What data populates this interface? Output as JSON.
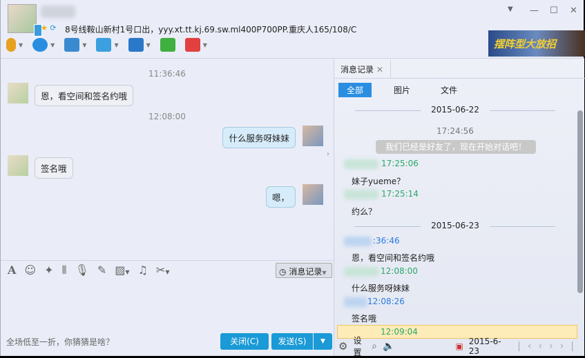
{
  "header": {
    "signature": "8号线鞍山新村1号口出，yyy.xt.tt.kj.69.sw.ml400P700PP.重庆人165/108/C",
    "ad_text": "摆阵型大放招",
    "window_buttons": [
      "menu",
      "minimize",
      "maximize",
      "close"
    ]
  },
  "toolbar": [
    {
      "icon": "microphone-icon",
      "color": "#e8a020"
    },
    {
      "icon": "camera-icon",
      "color": "#2a8ee0"
    },
    {
      "icon": "screen-share-icon",
      "color": "#3a8ad0"
    },
    {
      "icon": "file-transfer-icon",
      "color": "#3aa0e0"
    },
    {
      "icon": "remote-desktop-icon",
      "color": "#2a78c8"
    },
    {
      "icon": "add-chat-icon",
      "color": "#40b040"
    },
    {
      "icon": "apps-icon",
      "color": "#e04040"
    }
  ],
  "chat": {
    "messages": [
      {
        "time": "11:36:46",
        "text": "恩，看空间和签名约哦",
        "from": "them"
      },
      {
        "time": "12:08:00",
        "text": "什么服务呀妹妹",
        "from": "me"
      },
      {
        "text": "签名哦",
        "from": "them"
      },
      {
        "text": "嗯，",
        "from": "me"
      }
    ]
  },
  "editor": {
    "tools": [
      "font-icon",
      "emoji-icon",
      "magic-icon",
      "shake-icon",
      "voice-icon",
      "edit-icon",
      "image-icon",
      "music-icon",
      "scissors-icon"
    ],
    "history_button": "消息记录",
    "ad_text": "全场低至一折，你猜猜是啥？",
    "close_button": "关闭(C)",
    "send_button": "发送(S)"
  },
  "history": {
    "tab": "消息记录",
    "filters": [
      "全部",
      "图片",
      "文件"
    ],
    "active_filter": "全部",
    "date1": "2015-06-22",
    "sys_time": "17:24:56",
    "sys_msg": "我们已经是好友了，现在开始对话吧！",
    "entries1": [
      {
        "time": "17:25:06",
        "text": "妹子yueme？"
      },
      {
        "time": "17:25:14",
        "text": "约么？"
      }
    ],
    "date2": "2015-06-23",
    "entries2": [
      {
        "time": ":36:46",
        "text": "恩，看空间和签名约哦"
      },
      {
        "time": "12:08:00",
        "text": "什么服务呀妹妹"
      },
      {
        "time": "12:08:26",
        "text": "签名哦"
      },
      {
        "time": "12:09:04",
        "text": ""
      }
    ],
    "settings": "设置",
    "current_date": "2015-6-23"
  }
}
